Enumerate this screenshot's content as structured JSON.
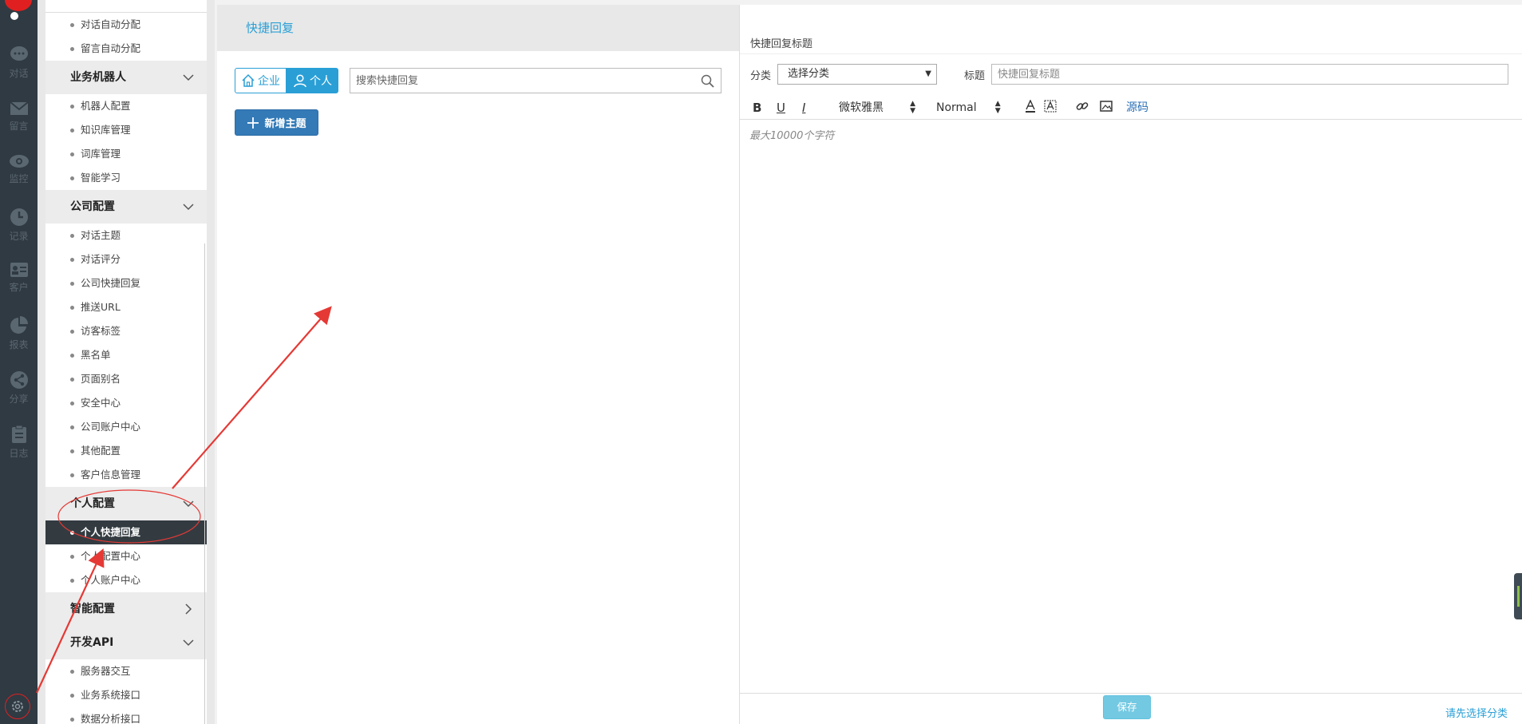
{
  "rail": {
    "items": [
      {
        "label": "对话",
        "icon": "chat-icon"
      },
      {
        "label": "留言",
        "icon": "mail-icon"
      },
      {
        "label": "监控",
        "icon": "eye-icon"
      },
      {
        "label": "记录",
        "icon": "clock-icon"
      },
      {
        "label": "客户",
        "icon": "id-card-icon"
      },
      {
        "label": "报表",
        "icon": "pie-chart-icon"
      },
      {
        "label": "分享",
        "icon": "share-icon"
      },
      {
        "label": "日志",
        "icon": "clipboard-icon"
      }
    ],
    "settings_icon": "gear-icon"
  },
  "menu": {
    "top_items": [
      "对话自动分配",
      "留言自动分配"
    ],
    "groups": [
      {
        "label": "业务机器人",
        "expanded": true,
        "items": [
          "机器人配置",
          "知识库管理",
          "词库管理",
          "智能学习"
        ]
      },
      {
        "label": "公司配置",
        "expanded": true,
        "items": [
          "对话主题",
          "对话评分",
          "公司快捷回复",
          "推送URL",
          "访客标签",
          "黑名单",
          "页面别名",
          "安全中心",
          "公司账户中心",
          "其他配置",
          "客户信息管理"
        ]
      },
      {
        "label": "个人配置",
        "expanded": true,
        "items": [
          "个人快捷回复",
          "个人配置中心",
          "个人账户中心"
        ],
        "active_item": "个人快捷回复"
      },
      {
        "label": "智能配置",
        "expanded": false,
        "items": []
      },
      {
        "label": "开发API",
        "expanded": true,
        "items": [
          "服务器交互",
          "业务系统接口",
          "数据分析接口"
        ]
      }
    ]
  },
  "middle": {
    "header": "快捷回复",
    "tab_enterprise": "企业",
    "tab_personal": "个人",
    "search_placeholder": "搜索快捷回复",
    "add_button": "新增主题"
  },
  "editor": {
    "section_title": "快捷回复标题",
    "category_label": "分类",
    "category_value": "选择分类",
    "title_label": "标题",
    "title_placeholder": "快捷回复标题",
    "toolbar": {
      "bold": "B",
      "underline": "U",
      "italic": "I",
      "font_family": "微软雅黑",
      "font_size": "Normal",
      "source": "源码"
    },
    "body_placeholder": "最大10000个字符",
    "save_button": "保存",
    "hint": "请先选择分类"
  },
  "colors": {
    "accent": "#2a9fd6",
    "primary_button": "#337ab7",
    "rail_bg": "#2f3a43",
    "active_item_bg": "#333b41",
    "annotation": "#e53935"
  }
}
